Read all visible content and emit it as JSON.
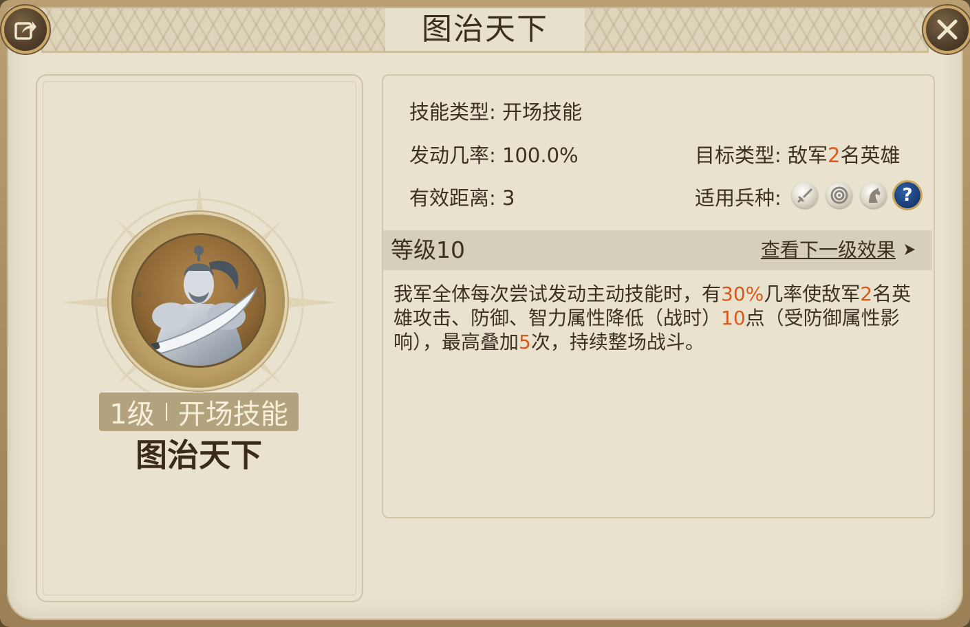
{
  "title": "图治天下",
  "buttons": {
    "share_icon": "share-icon",
    "close_icon": "close-icon"
  },
  "left": {
    "level": "1级",
    "type": "开场技能",
    "name": "图治天下"
  },
  "info": {
    "skill_type_label": "技能类型:",
    "skill_type_value": "开场技能",
    "trigger_rate_label": "发动几率:",
    "trigger_rate_value": "100.0%",
    "range_label": "有效距离:",
    "range_value": "3",
    "target_label": "目标类型:",
    "target_prefix": "敌军",
    "target_count": "2",
    "target_suffix": "名英雄",
    "unit_label": "适用兵种:",
    "unit_icons": [
      "sword-icon",
      "bow-target-icon",
      "cavalry-horse-icon",
      "help-question-icon"
    ],
    "help_glyph": "?"
  },
  "level_bar": {
    "title": "等级10",
    "next_link": "查看下一级效果"
  },
  "description": {
    "p1": "我军全体每次尝试发动主动技能时，有",
    "v1": "30%",
    "p2": "几率使敌军",
    "v2": "2",
    "p3": "名英雄攻击、防御、智力属性降低（战时）",
    "v3": "10",
    "p4": "点（受防御属性影响），最高叠加",
    "v4": "5",
    "p5": "次，持续整场战斗。"
  },
  "colors": {
    "highlight": "#d8591b",
    "text": "#3d3020",
    "panel_bg": "#e8e2cf"
  }
}
